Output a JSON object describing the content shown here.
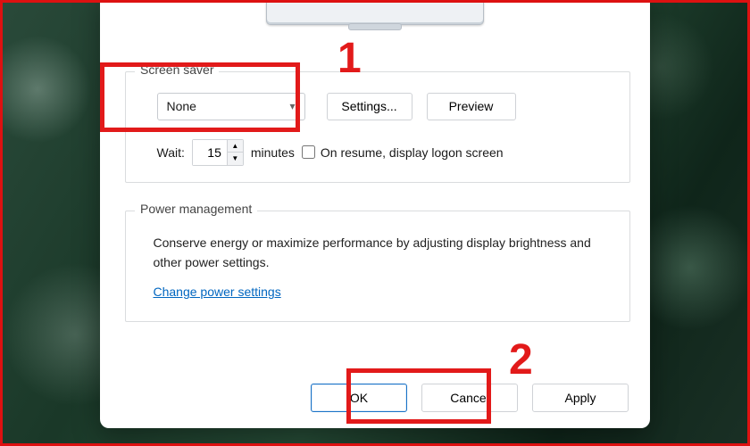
{
  "screensaver": {
    "legend": "Screen saver",
    "selected": "None",
    "btn_settings": "Settings...",
    "btn_preview": "Preview",
    "wait_label": "Wait:",
    "wait_value": "15",
    "minutes_label": "minutes",
    "resume_label": "On resume, display logon screen",
    "resume_checked": false
  },
  "power": {
    "legend": "Power management",
    "text": "Conserve energy or maximize performance by adjusting display brightness and other power settings.",
    "link": "Change power settings"
  },
  "buttons": {
    "ok": "OK",
    "cancel": "Cancel",
    "apply": "Apply"
  },
  "annotations": {
    "n1": "1",
    "n2": "2"
  }
}
